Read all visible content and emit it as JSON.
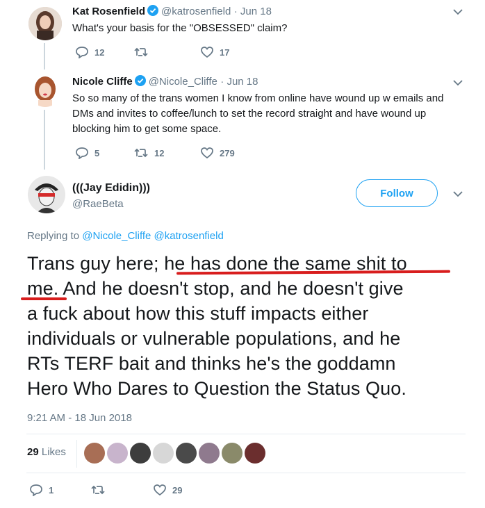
{
  "tweets": [
    {
      "author_name": "Kat Rosenfield",
      "handle": "@katrosenfield",
      "date": "· Jun 18",
      "text": "What's your basis for the \"OBSESSED\" claim?",
      "replies": "12",
      "retweets": "",
      "likes": "17"
    },
    {
      "author_name": "Nicole Cliffe",
      "handle": "@Nicole_Cliffe",
      "date": "· Jun 18",
      "text_lines": [
        "So so many of the trans women I know from online have wound up w emails and",
        "DMs and invites to coffee/lunch to set the record straight and have wound up",
        "blocking him to get some space."
      ],
      "replies": "5",
      "retweets": "12",
      "likes": "279"
    }
  ],
  "main_tweet": {
    "author_name": "(((Jay Edidin)))",
    "handle": "@RaeBeta",
    "follow_label": "Follow",
    "replying_to_label": "Replying to",
    "replying_to_handles": [
      "@Nicole_Cliffe",
      "@katrosenfield"
    ],
    "text_lines": [
      "Trans guy here; he has done the same shit to",
      "me. And he doesn't stop, and he doesn't give",
      "a fuck about how this stuff impacts either",
      "individuals or vulnerable populations, and he",
      "RTs TERF bait and thinks he's the goddamn",
      "Hero Who Dares to Question the Status Quo."
    ],
    "timestamp": "9:21 AM - 18 Jun 2018",
    "likes_count": "29",
    "likes_label": "Likes",
    "replies": "1",
    "retweets": "",
    "likes": "29"
  },
  "colors": {
    "accent": "#1da1f2",
    "muted": "#657786",
    "highlight_underline": "#d81d1d",
    "divider": "#e6ecf0"
  },
  "icons": [
    "reply-icon",
    "retweet-icon",
    "heart-icon",
    "chevron-down-icon",
    "verified-badge-icon"
  ]
}
